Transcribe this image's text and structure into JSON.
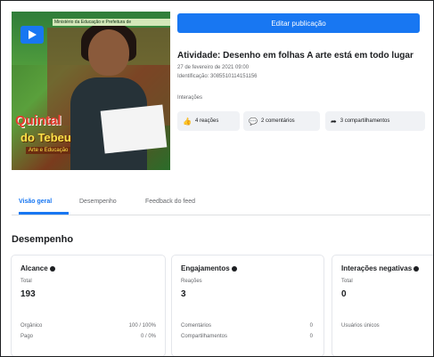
{
  "thumbnail": {
    "caption": "Ministério da Educação e Prefeitura de",
    "logo_line1": "Quintal",
    "logo_line2": "do Tebeu",
    "logo_line3": "Arte e Educação"
  },
  "header": {
    "edit_button": "Editar publicação",
    "post_title": "Atividade: Desenho em folhas A arte está em todo lugar",
    "post_date": "27 de fevereiro de 2021 09:00",
    "post_id": "Identificação: 3085510114151156",
    "interactions_label": "Interações"
  },
  "interactions": [
    {
      "icon": "thumbs-up-icon",
      "label": "4 reações"
    },
    {
      "icon": "comment-icon",
      "label": "2 comentários"
    },
    {
      "icon": "share-icon",
      "label": "3 compartilhamentos"
    }
  ],
  "tabs": [
    "Visão geral",
    "Desempenho",
    "Feedback do feed"
  ],
  "section_title": "Desempenho",
  "cards": {
    "reach": {
      "title": "Alcance",
      "sub": "Total",
      "value": "193",
      "rows": [
        {
          "label": "Orgânico",
          "value": "100 / 100%"
        },
        {
          "label": "Pago",
          "value": "0 / 0%"
        }
      ]
    },
    "engagement": {
      "title": "Engajamentos",
      "sub": "Reações",
      "value": "3",
      "rows": [
        {
          "label": "Comentários",
          "value": "0"
        },
        {
          "label": "Compartilhamentos",
          "value": "0"
        }
      ]
    },
    "negative": {
      "title": "Interações negativas",
      "sub": "Total",
      "value": "0",
      "rows": [
        {
          "label": "Usuários únicos",
          "value": ""
        }
      ]
    }
  }
}
